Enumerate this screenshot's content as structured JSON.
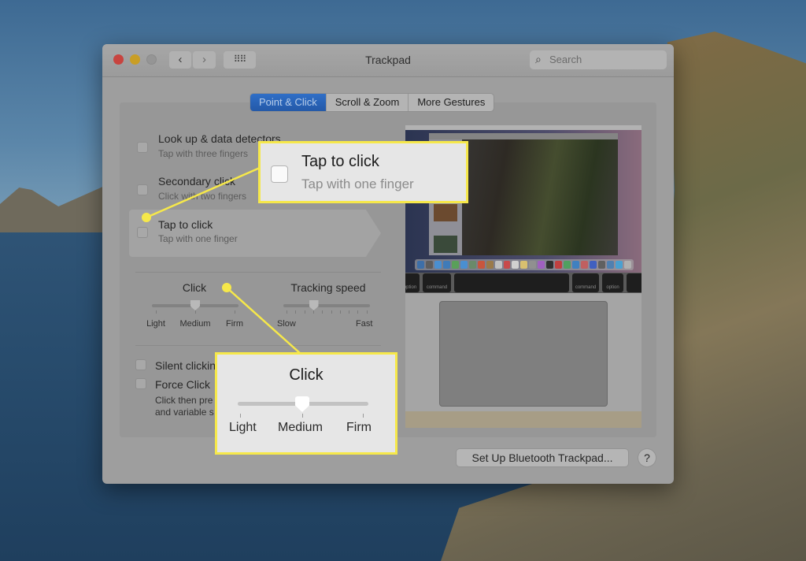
{
  "window": {
    "title": "Trackpad",
    "search_placeholder": "Search",
    "nav": {
      "back": "‹",
      "forward": "›",
      "grid": "⠿⠿"
    }
  },
  "tabs": [
    {
      "label": "Point & Click",
      "active": true
    },
    {
      "label": "Scroll & Zoom",
      "active": false
    },
    {
      "label": "More Gestures",
      "active": false
    }
  ],
  "options": [
    {
      "title": "Look up & data detectors",
      "subtitle": "Tap with three fingers",
      "checked": false
    },
    {
      "title": "Secondary click",
      "subtitle": "Click with two fingers",
      "checked": false
    },
    {
      "title": "Tap to click",
      "subtitle": "Tap with one finger",
      "checked": false
    }
  ],
  "sliders": {
    "click": {
      "label": "Click",
      "ticks": [
        "Light",
        "Medium",
        "Firm"
      ],
      "value": "Medium",
      "fraction": 0.5
    },
    "tracking": {
      "label": "Tracking speed",
      "min_label": "Slow",
      "max_label": "Fast",
      "fraction": 0.35
    }
  },
  "bottom_options": [
    {
      "title": "Silent clicking",
      "visible_text": "Silent clickin",
      "checked": false
    },
    {
      "title": "Force Click",
      "visible_text": "Force Click",
      "checked": false,
      "description_line1": "Click then pre",
      "description_line2": "and variable s"
    }
  ],
  "preview": {
    "keys": [
      "option",
      "command",
      "",
      "command",
      "option"
    ]
  },
  "buttons": {
    "setup_bluetooth": "Set Up Bluetooth Trackpad...",
    "help": "?"
  },
  "callouts": {
    "tap_to_click": {
      "title": "Tap to click",
      "subtitle": "Tap with one finger"
    },
    "click": {
      "title": "Click",
      "ticks": [
        "Light",
        "Medium",
        "Firm"
      ],
      "value": "Medium"
    },
    "color": "#f6e84a"
  }
}
